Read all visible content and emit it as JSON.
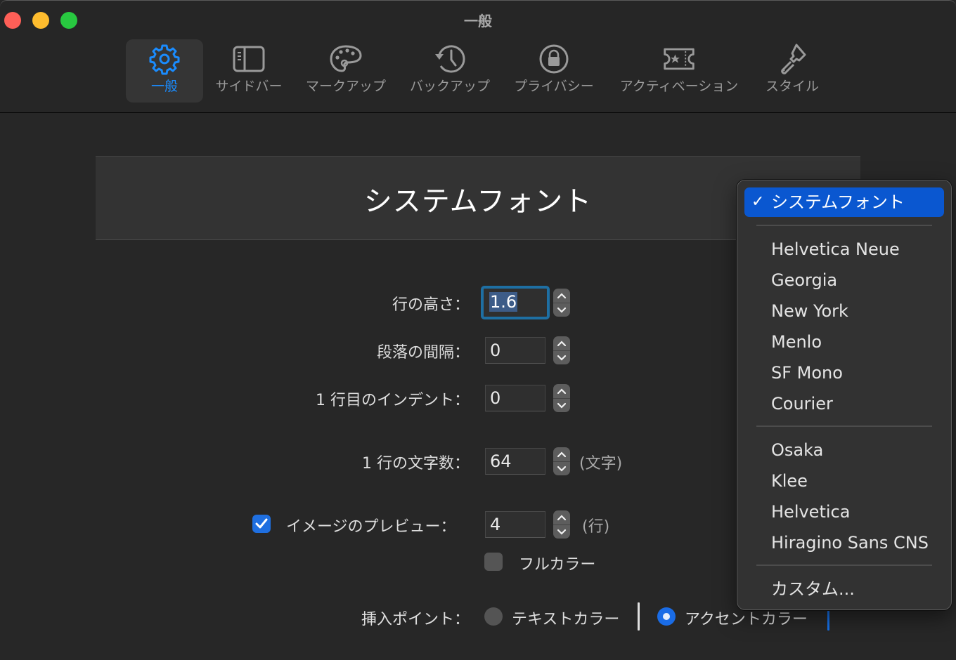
{
  "window": {
    "title": "一般",
    "traffic_lights": [
      "close",
      "minimize",
      "maximize"
    ]
  },
  "toolbar": {
    "tabs": [
      {
        "label": "一般",
        "icon": "gear-icon",
        "active": true
      },
      {
        "label": "サイドバー",
        "icon": "sidebar-icon",
        "active": false
      },
      {
        "label": "マークアップ",
        "icon": "palette-icon",
        "active": false
      },
      {
        "label": "バックアップ",
        "icon": "clock-history-icon",
        "active": false
      },
      {
        "label": "プライバシー",
        "icon": "lock-icon",
        "active": false
      },
      {
        "label": "アクティベーション",
        "icon": "ticket-star-icon",
        "active": false
      },
      {
        "label": "スタイル",
        "icon": "paintbrush-icon",
        "active": false
      }
    ]
  },
  "font_preview": {
    "text": "システムフォント"
  },
  "settings": {
    "line_height": {
      "label": "行の高さ：",
      "value": "1.6"
    },
    "paragraph_spacing": {
      "label": "段落の間隔：",
      "value": "0"
    },
    "first_line_indent": {
      "label": "1 行目のインデント：",
      "value": "0"
    },
    "chars_per_line": {
      "label": "1 行の文字数：",
      "value": "64",
      "unit": "(文字)"
    },
    "image_preview": {
      "label": "イメージのプレビュー：",
      "checked": true,
      "value": "4",
      "unit": "(行)"
    },
    "full_color": {
      "label": "フルカラー",
      "checked": false
    },
    "insertion_point": {
      "label": "挿入ポイント：",
      "options": [
        {
          "label": "テキストカラー",
          "selected": false
        },
        {
          "label": "アクセントカラー",
          "selected": true
        }
      ]
    }
  },
  "font_menu": {
    "selected": "システムフォント",
    "groups": [
      [
        "システムフォント"
      ],
      [
        "Helvetica Neue",
        "Georgia",
        "New York",
        "Menlo",
        "SF Mono",
        "Courier"
      ],
      [
        "Osaka",
        "Klee",
        "Helvetica",
        "Hiragino Sans CNS"
      ],
      [
        "カスタム..."
      ]
    ],
    "check_mark": "✓"
  },
  "colors": {
    "accent": "#1a8cff",
    "menu_highlight": "#0a57d0",
    "checkbox_on": "#1f6fe0",
    "accent_caret": "#1570e8",
    "text_caret": "#e0e0e0"
  }
}
